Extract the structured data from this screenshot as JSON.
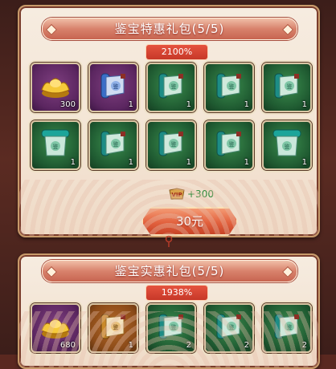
{
  "packs": [
    {
      "title": "鉴宝特惠礼包(5/5)",
      "percent": "2100%",
      "vip_text": "+300",
      "price": "30元",
      "items": [
        {
          "icon": "gold-ingot-icon",
          "count": "300",
          "bg": "purple"
        },
        {
          "icon": "blue-scroll-icon",
          "count": "1",
          "bg": "purple"
        },
        {
          "icon": "jade-scroll-icon",
          "count": "1",
          "bg": "green"
        },
        {
          "icon": "jade-scroll-icon",
          "count": "1",
          "bg": "green"
        },
        {
          "icon": "jade-scroll-icon",
          "count": "1",
          "bg": "green"
        },
        {
          "icon": "teal-scroll-icon",
          "count": "1",
          "bg": "green"
        },
        {
          "icon": "jade-scroll-icon",
          "count": "1",
          "bg": "green"
        },
        {
          "icon": "jade-scroll-icon",
          "count": "1",
          "bg": "green"
        },
        {
          "icon": "jade-scroll-icon",
          "count": "1",
          "bg": "green"
        },
        {
          "icon": "teal-scroll-icon",
          "count": "1",
          "bg": "green"
        }
      ]
    },
    {
      "title": "鉴宝实惠礼包(5/5)",
      "percent": "1938%",
      "items": [
        {
          "icon": "gold-ingot-icon",
          "count": "680",
          "bg": "purple"
        },
        {
          "icon": "gold-scroll-icon",
          "count": "1",
          "bg": "orange"
        },
        {
          "icon": "jade-scroll-icon",
          "count": "2",
          "bg": "green"
        },
        {
          "icon": "jade-scroll-icon",
          "count": "2",
          "bg": "green"
        },
        {
          "icon": "jade-scroll-icon",
          "count": "2",
          "bg": "green"
        }
      ]
    }
  ],
  "vip_label": "VIP",
  "colors": {
    "accent": "#e2613e",
    "vip_green": "#2e8a3a",
    "panel": "#f3e4d4"
  }
}
